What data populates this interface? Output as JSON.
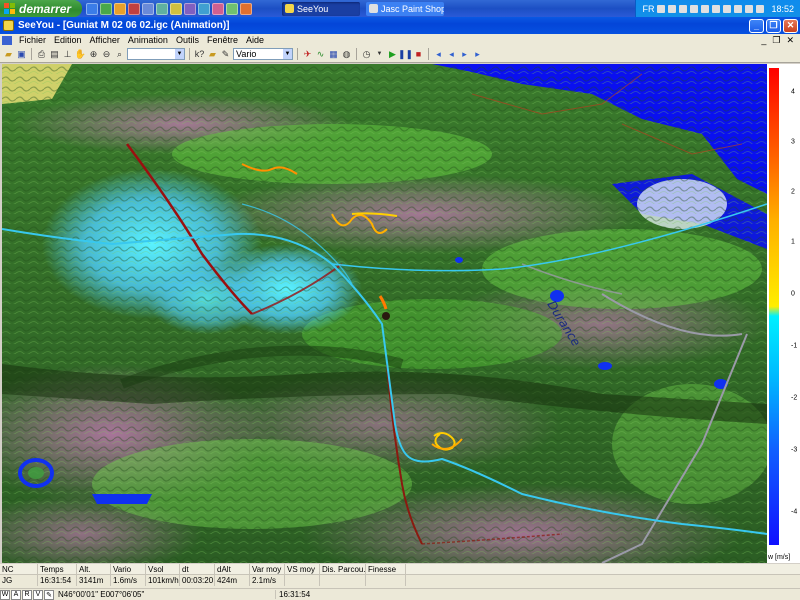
{
  "taskbar": {
    "start_label": "demarrer",
    "tasks": [
      {
        "label": "SeeYou",
        "active": true
      },
      {
        "label": "Jasc Paint Shop ...",
        "active": false
      }
    ],
    "lang": "FR",
    "clock": "18:52"
  },
  "window": {
    "title": "SeeYou - [Guniat M 02 06 02.igc (Animation)]"
  },
  "menu": {
    "items": [
      "Fichier",
      "Edition",
      "Afficher",
      "Animation",
      "Outils",
      "Fenêtre",
      "Aide"
    ]
  },
  "toolbar": {
    "combo_value": "Vario"
  },
  "view3d": {
    "map_label": "Durance"
  },
  "scale": {
    "ticks": [
      "4",
      "3",
      "2",
      "1",
      "0",
      "-1",
      "-2",
      "-3",
      "-4"
    ],
    "unit": "w [m/s]",
    "colors": [
      "#ff0000",
      "#ff6a00",
      "#ffee00",
      "#00f0ff",
      "#1010ff"
    ]
  },
  "status": {
    "headers": [
      "NC",
      "Temps",
      "Alt.",
      "Vario",
      "Vsol",
      "dt",
      "dAlt",
      "Var moy",
      "VS moy",
      "Dis. Parcou...",
      "Finesse"
    ],
    "values": [
      "JG",
      "16:31:54",
      "3141m",
      "1.6m/s",
      "101km/h",
      "00:03:20",
      "424m",
      "2.1m/s",
      "",
      "",
      ""
    ],
    "footer_buttons": [
      "W",
      "A",
      "R",
      "V"
    ],
    "coords": "N46°00'01\"  E007°06'05\"",
    "time": "16:31:54"
  }
}
